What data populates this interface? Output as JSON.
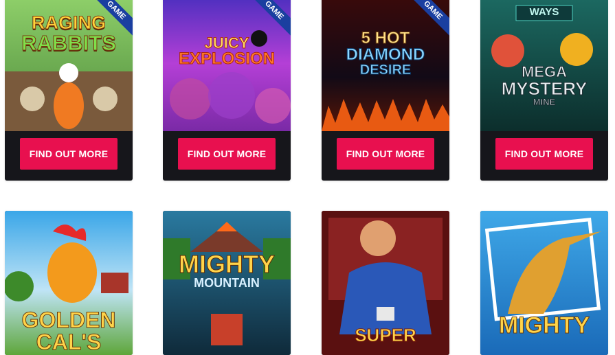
{
  "cta_label": "FIND OUT MORE",
  "ribbon_label": "GAME",
  "row1": [
    {
      "name": "Raging Rabbits",
      "logo_lines": [
        "RAGING",
        "RABBITS"
      ],
      "has_ribbon": true
    },
    {
      "name": "Juicy Explosion",
      "logo_lines": [
        "JUICY",
        "EXPLOSION"
      ],
      "has_ribbon": true
    },
    {
      "name": "5 Hot Diamond Desire",
      "logo_lines": [
        "5 HOT",
        "DIAMOND",
        "DESIRE"
      ],
      "has_ribbon": true
    },
    {
      "name": "Mega Mystery Mine",
      "logo_lines": [
        "WAYS",
        "MEGA",
        "MYSTERY",
        "MINE"
      ],
      "has_ribbon": false
    }
  ],
  "row2": [
    {
      "name": "Golden Cal's",
      "logo_lines": [
        "GOLDEN",
        "CAL'S"
      ]
    },
    {
      "name": "Mighty Mountain",
      "logo_lines": [
        "MIGHTY",
        "MOUNTAIN"
      ]
    },
    {
      "name": "Super",
      "logo_lines": [
        "SUPER"
      ]
    },
    {
      "name": "Mighty",
      "logo_lines": [
        "MIGHTY"
      ]
    }
  ],
  "colors": {
    "page_bg": "#ffffff",
    "card_bg": "#16161b",
    "cta_bg": "#e8104f",
    "ribbon_bg": "#1a3fa0"
  }
}
